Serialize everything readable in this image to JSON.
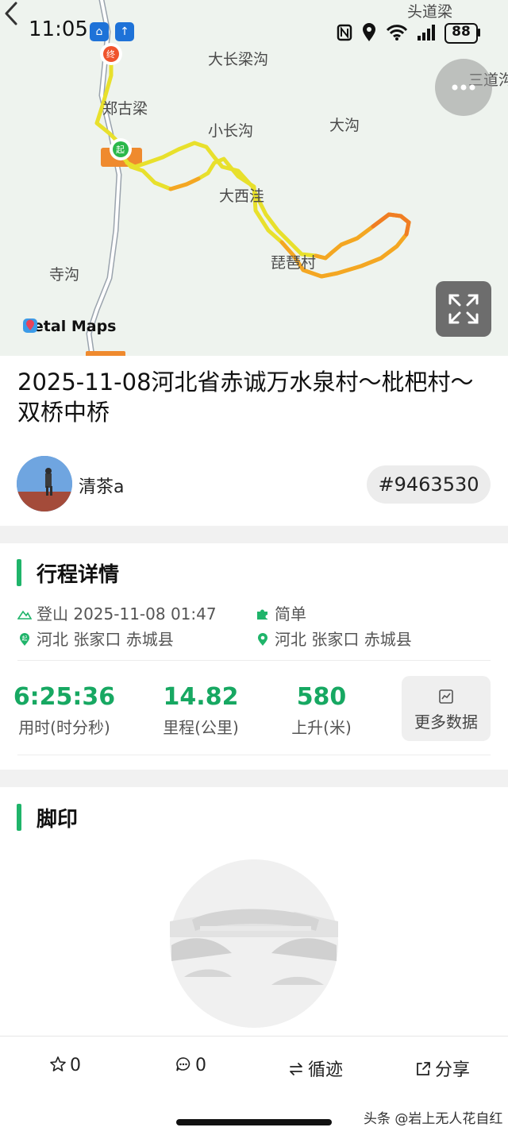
{
  "status_bar": {
    "time": "11:05",
    "battery": "88"
  },
  "map": {
    "places": [
      "头道梁",
      "大长梁沟",
      "三道沟",
      "郑古梁",
      "小长沟",
      "大沟",
      "大西洼",
      "琵琶村",
      "寺沟"
    ],
    "attribution": "Petal Maps",
    "start_marker": "起",
    "end_marker": "终",
    "route_colors": [
      "#e8e02c",
      "#f4a623",
      "#f07d24"
    ]
  },
  "track": {
    "title": "2025-11-08河北省赤诚万水泉村～枇杷村～双桥中桥",
    "user_name": "清茶a",
    "track_id": "#9463530"
  },
  "details": {
    "section_title": "行程详情",
    "activity": "登山",
    "datetime": "2025-11-08 01:47",
    "difficulty": "简单",
    "start_location": "河北 张家口 赤城县",
    "end_location": "河北 张家口 赤城县",
    "stats": [
      {
        "value": "6:25:36",
        "label": "用时(时分秒)"
      },
      {
        "value": "14.82",
        "label": "里程(公里)"
      },
      {
        "value": "580",
        "label": "上升(米)"
      }
    ],
    "more_data_label": "更多数据"
  },
  "footprint": {
    "section_title": "脚印"
  },
  "bottom_bar": {
    "likes": "0",
    "comments": "0",
    "follow_label": "循迹",
    "share_label": "分享"
  },
  "watermark": "头条 @岩上无人花自红",
  "colors": {
    "accent": "#1fb46a",
    "stat_value": "#17a862"
  }
}
